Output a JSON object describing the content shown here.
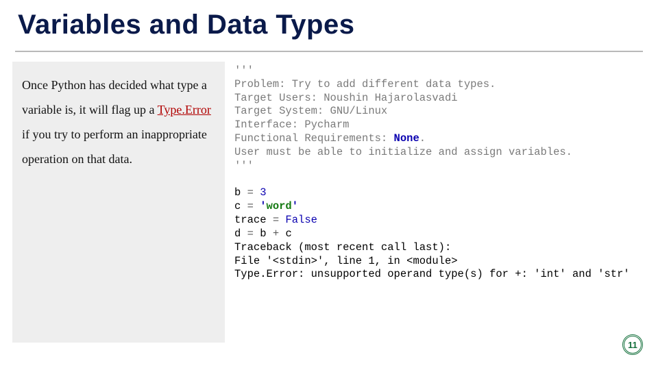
{
  "title": "Variables and Data Types",
  "prose": {
    "pre": "Once Python has decided what type a variable is, it will flag up a ",
    "emph": "Type.Error",
    "post": " if you try to perform an inappropriate operation on that data."
  },
  "code": {
    "q": "'''",
    "c1": "Problem: Try to add different data types.",
    "c2": "Target Users: Noushin Hajarolasvadi",
    "c3": "Target System: GNU/Linux",
    "c4": "Interface: Pycharm",
    "c5": "Functional Requirements: ",
    "c5b": "None",
    "c5c": ".",
    "c6": "User must be able to initialize and assign variables.",
    "l1a": "b ",
    "l1b": "= ",
    "l1c": "3",
    "l2a": "c ",
    "l2b": "= ",
    "l2q": "'",
    "l2s": "word",
    "l3a": "trace ",
    "l3b": "= ",
    "l3c": "False",
    "l4a": "d ",
    "l4b": "= ",
    "l4c": "b ",
    "l4d": "+ ",
    "l4e": "c",
    "l5": "Traceback (most recent call last):",
    "l6": "File '<stdin>', line 1, in <module>",
    "l7": "Type.Error: unsupported operand type(s) for +: 'int' and 'str'"
  },
  "page": "11"
}
